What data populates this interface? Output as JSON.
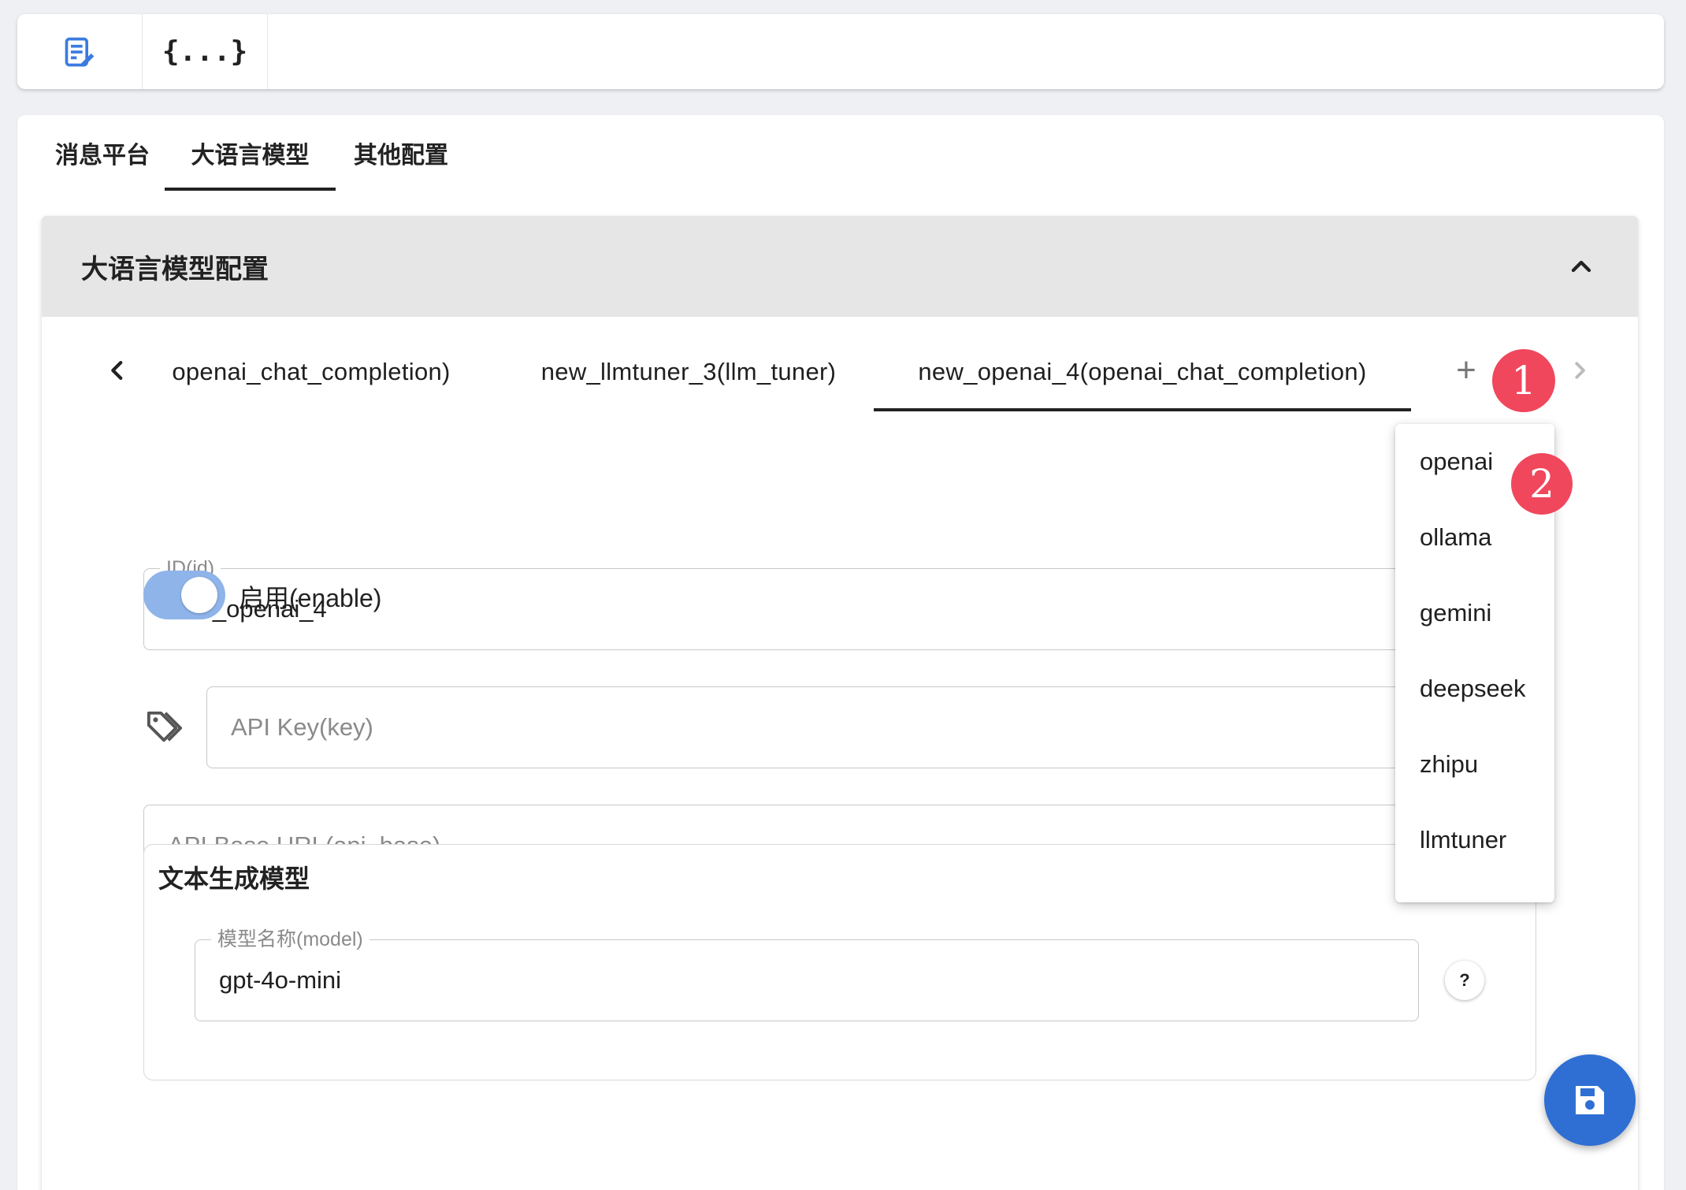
{
  "toolbar": {
    "items": [
      {
        "icon": "edit-document-icon"
      },
      {
        "icon": "json-braces-icon",
        "glyph": "{...}"
      }
    ]
  },
  "top_tabs": [
    {
      "label": "消息平台",
      "active": false
    },
    {
      "label": "大语言模型",
      "active": true
    },
    {
      "label": "其他配置",
      "active": false
    }
  ],
  "panel": {
    "title": "大语言模型配置",
    "collapse_icon": "chevron-up-icon"
  },
  "provider_tabs": {
    "items": [
      {
        "label": "openai_chat_completion)",
        "active": false
      },
      {
        "label": "new_llmtuner_3(llm_tuner)",
        "active": false
      },
      {
        "label": "new_openai_4(openai_chat_completion)",
        "active": true
      }
    ],
    "add_label": "+"
  },
  "form": {
    "id_field": {
      "label": "ID(id)",
      "value": "new_openai_4"
    },
    "enable_toggle": {
      "label": "启用(enable)",
      "on": true
    },
    "api_key_field": {
      "placeholder": "API Key(key)",
      "icon": "tag-icon"
    },
    "api_base_field": {
      "placeholder": "API Base URL(api_base)"
    },
    "text_model_section": {
      "title": "文本生成模型",
      "model_field": {
        "label": "模型名称(model)",
        "value": "gpt-4o-mini"
      },
      "help_label": "?"
    }
  },
  "dropdown_menu": {
    "items": [
      "openai",
      "ollama",
      "gemini",
      "deepseek",
      "zhipu",
      "llmtuner"
    ]
  },
  "annotations": [
    "1",
    "2"
  ],
  "colors": {
    "accent": "#2f6fd3",
    "toggle_track": "#8fb4ea",
    "badge": "#f0475d",
    "panel_header": "#e6e6e6"
  },
  "fab": {
    "icon": "save-icon"
  }
}
